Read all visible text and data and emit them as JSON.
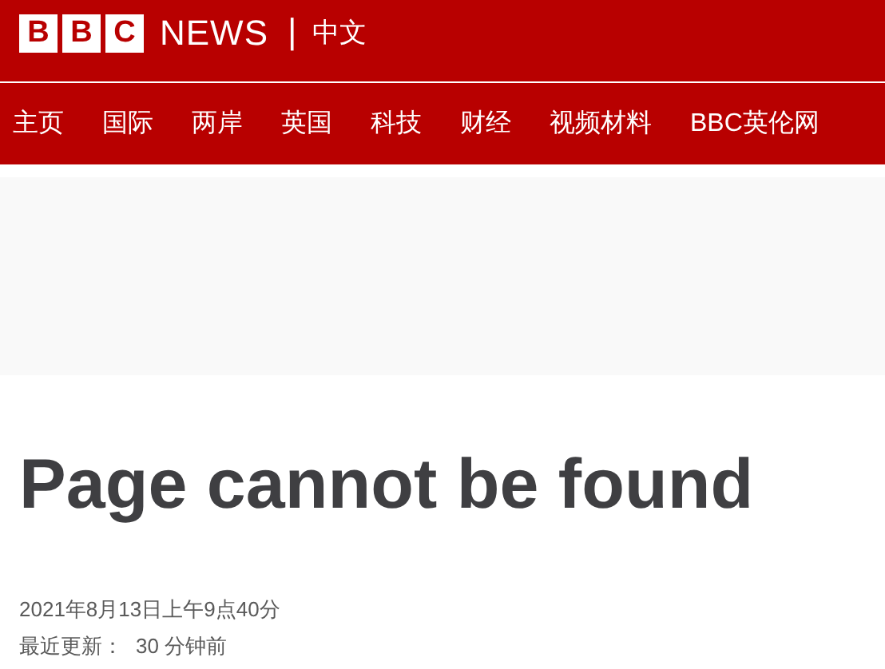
{
  "header": {
    "logo_letters": [
      "B",
      "B",
      "C"
    ],
    "brand": "NEWS",
    "separator": "|",
    "edition": "中文"
  },
  "nav": [
    {
      "label": "主页"
    },
    {
      "label": "国际"
    },
    {
      "label": "两岸"
    },
    {
      "label": "英国"
    },
    {
      "label": "科技"
    },
    {
      "label": "财经"
    },
    {
      "label": "视频材料"
    },
    {
      "label": "BBC英伦网"
    }
  ],
  "article": {
    "title": "Page cannot be found",
    "date": "2021年8月13日上午9点40分",
    "updated_label": "最近更新：",
    "updated_value": "30 分钟前"
  }
}
